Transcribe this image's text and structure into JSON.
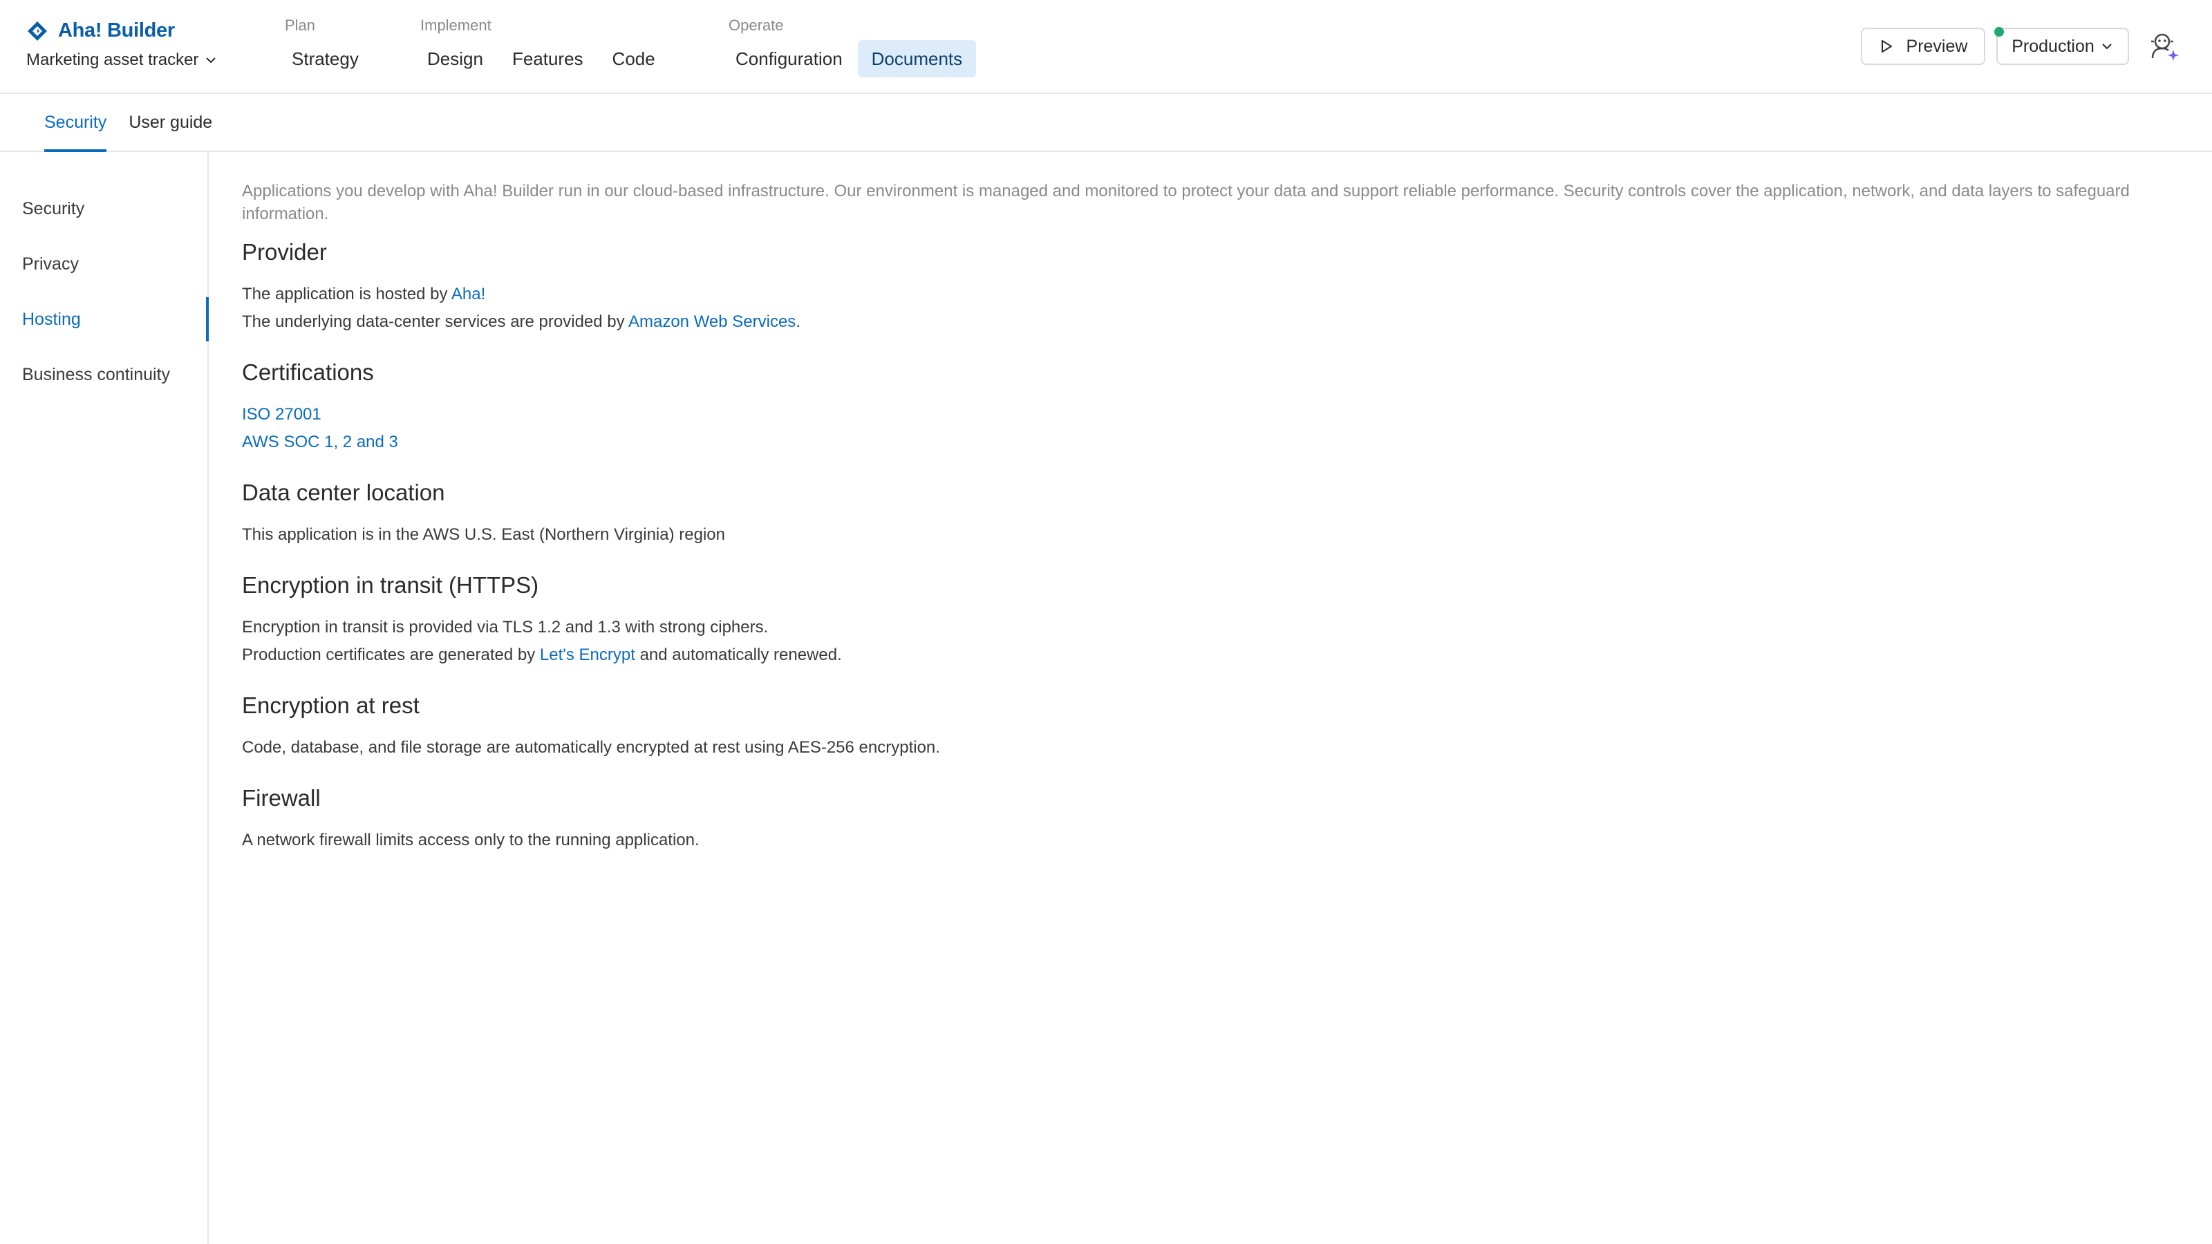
{
  "brand": {
    "name": "Aha! Builder",
    "logo_icon": "aha-diamond-icon",
    "color": "#0a5ea8"
  },
  "project": {
    "name": "Marketing asset tracker"
  },
  "nav": {
    "groups": [
      {
        "label": "Plan",
        "items": [
          {
            "label": "Strategy"
          }
        ]
      },
      {
        "label": "Implement",
        "items": [
          {
            "label": "Design"
          },
          {
            "label": "Features"
          },
          {
            "label": "Code"
          }
        ]
      },
      {
        "label": "Operate",
        "items": [
          {
            "label": "Configuration"
          },
          {
            "label": "Documents",
            "active": true
          }
        ]
      }
    ]
  },
  "toolbar": {
    "preview_label": "Preview",
    "environment": {
      "value": "Production",
      "status_color": "#1fa971"
    },
    "ai_icon": "ai-assistant-icon"
  },
  "subtabs": [
    {
      "label": "Security",
      "active": true
    },
    {
      "label": "User guide"
    }
  ],
  "sidebar": {
    "items": [
      {
        "label": "Security"
      },
      {
        "label": "Privacy"
      },
      {
        "label": "Hosting",
        "active": true
      },
      {
        "label": "Business continuity"
      }
    ]
  },
  "content": {
    "intro": "Applications you develop with Aha! Builder run in our cloud-based infrastructure. Our environment is managed and monitored to protect your data and support reliable performance. Security controls cover the application, network, and data layers to safeguard information.",
    "provider": {
      "title": "Provider",
      "line1_prefix": "The application is hosted by ",
      "line1_link": "Aha!",
      "line2_prefix": "The underlying data-center services are provided by ",
      "line2_link": "Amazon Web Services",
      "line2_suffix": "."
    },
    "certifications": {
      "title": "Certifications",
      "items": [
        "ISO 27001",
        "AWS SOC 1, 2 and 3"
      ]
    },
    "datacenter": {
      "title": "Data center location",
      "text": "This application is in the AWS U.S. East (Northern Virginia) region"
    },
    "transit": {
      "title": "Encryption in transit (HTTPS)",
      "line1": "Encryption in transit is provided via TLS 1.2 and 1.3 with strong ciphers.",
      "line2_prefix": "Production certificates are generated by ",
      "line2_link": "Let's Encrypt",
      "line2_suffix": " and automatically renewed."
    },
    "rest": {
      "title": "Encryption at rest",
      "text": "Code, database, and file storage are automatically encrypted at rest using AES-256 encryption."
    },
    "firewall": {
      "title": "Firewall",
      "text": "A network firewall limits access only to the running application."
    }
  },
  "colors": {
    "accent": "#0a6bbf",
    "active_nav_bg": "#dcecfa",
    "muted_text": "#8a8a8a"
  }
}
